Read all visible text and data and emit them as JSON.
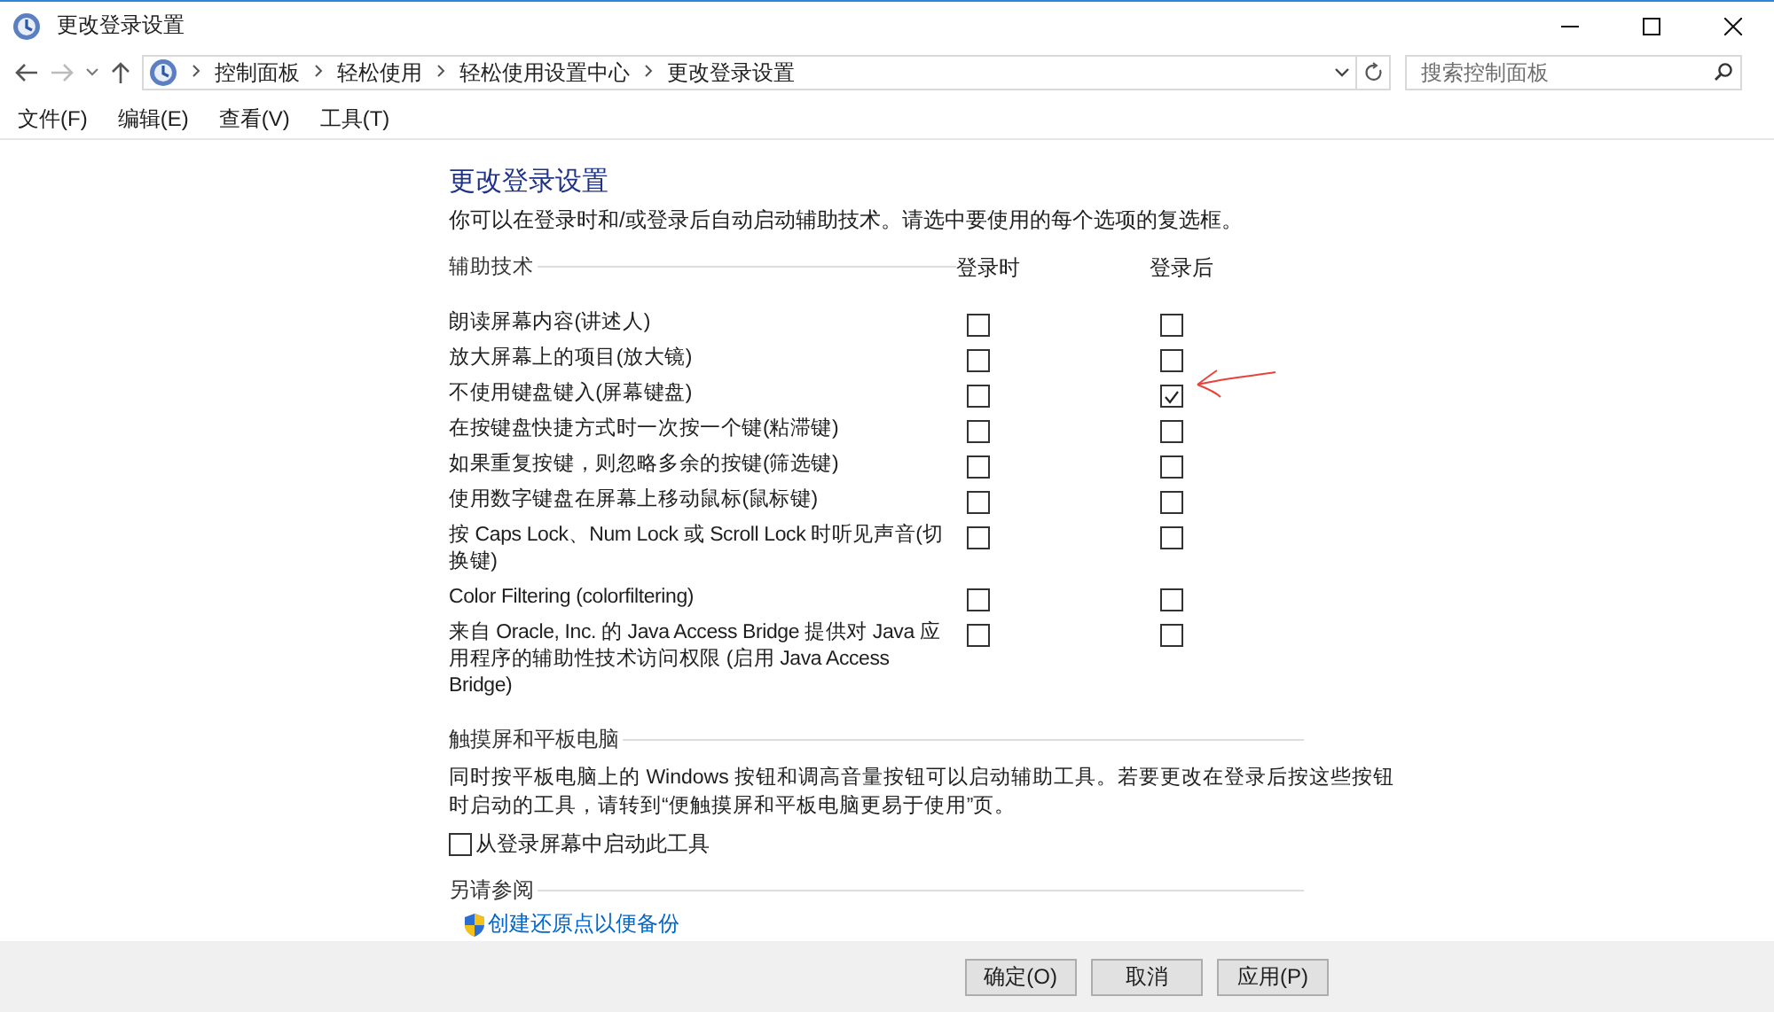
{
  "window": {
    "title": "更改登录设置"
  },
  "nav": {
    "breadcrumb": [
      "控制面板",
      "轻松使用",
      "轻松使用设置中心",
      "更改登录设置"
    ],
    "search": {
      "placeholder": "搜索控制面板"
    }
  },
  "menu": [
    "文件(F)",
    "编辑(E)",
    "查看(V)",
    "工具(T)"
  ],
  "page": {
    "heading": "更改登录设置",
    "intro": "你可以在登录时和/或登录后自动启动辅助技术。请选中要使用的每个选项的复选框。",
    "assistive": {
      "heading": "辅助技术",
      "columns": [
        "登录时",
        "登录后"
      ],
      "rows": [
        {
          "label": "朗读屏幕内容(讲述人)",
          "at_login": false,
          "after_login": false
        },
        {
          "label": "放大屏幕上的项目(放大镜)",
          "at_login": false,
          "after_login": false
        },
        {
          "label": "不使用键盘键入(屏幕键盘)",
          "at_login": false,
          "after_login": true
        },
        {
          "label": "在按键盘快捷方式时一次按一个键(粘滞键)",
          "at_login": false,
          "after_login": false
        },
        {
          "label": "如果重复按键，则忽略多余的按键(筛选键)",
          "at_login": false,
          "after_login": false
        },
        {
          "label": "使用数字键盘在屏幕上移动鼠标(鼠标键)",
          "at_login": false,
          "after_login": false
        },
        {
          "label": "按 Caps Lock、Num Lock 或 Scroll Lock 时听见声音(切换键)",
          "at_login": false,
          "after_login": false
        },
        {
          "label": "Color Filtering (colorfiltering)",
          "at_login": false,
          "after_login": false
        },
        {
          "label": "来自 Oracle, Inc. 的 Java Access Bridge 提供对 Java 应用程序的辅助性技术访问权限 (启用 Java Access Bridge)",
          "at_login": false,
          "after_login": false
        }
      ]
    },
    "touch": {
      "heading": "触摸屏和平板电脑",
      "text": "同时按平板电脑上的 Windows 按钮和调高音量按钮可以启动辅助工具。若要更改在登录后按这些按钮时启动的工具，请转到“便触摸屏和平板电脑更易于使用”页。",
      "option": {
        "label": "从登录屏幕中启动此工具",
        "checked": false
      }
    },
    "see_also": {
      "heading": "另请参阅",
      "links": [
        "创建还原点以便备份"
      ]
    }
  },
  "buttons": [
    "确定(O)",
    "取消",
    "应用(P)"
  ]
}
